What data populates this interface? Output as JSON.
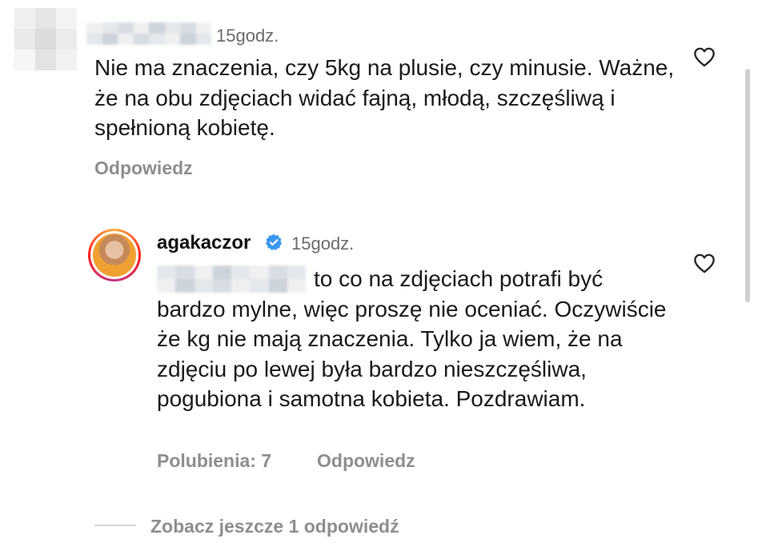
{
  "comment1": {
    "timestamp": "15godz.",
    "text": "Nie ma znaczenia, czy 5kg na plusie, czy minusie. Ważne, że na obu zdjęciach widać fajną, młodą, szczęśliwą i spełnioną kobietę.",
    "reply_label": "Odpowiedz",
    "like_icon": "heart-outline-icon"
  },
  "reply": {
    "username": "agakaczor",
    "verified_icon": "verified-badge-icon",
    "timestamp": "15godz.",
    "text": "to co na zdjęciach potrafi być bardzo mylne, więc proszę nie oceniać. Oczywiście że kg nie mają znaczenia. Tylko ja wiem, że na zdjęciu po lewej była bardzo nieszczęśliwa, pogubiona i samotna kobieta. Pozdrawiam.",
    "likes_label": "Polubienia: 7",
    "reply_label": "Odpowiedz",
    "like_icon": "heart-outline-icon"
  },
  "more_replies": {
    "label": "Zobacz jeszcze 1 odpowiedź"
  },
  "colors": {
    "verified": "#3897f0",
    "meta_text": "#8e8e8e"
  }
}
